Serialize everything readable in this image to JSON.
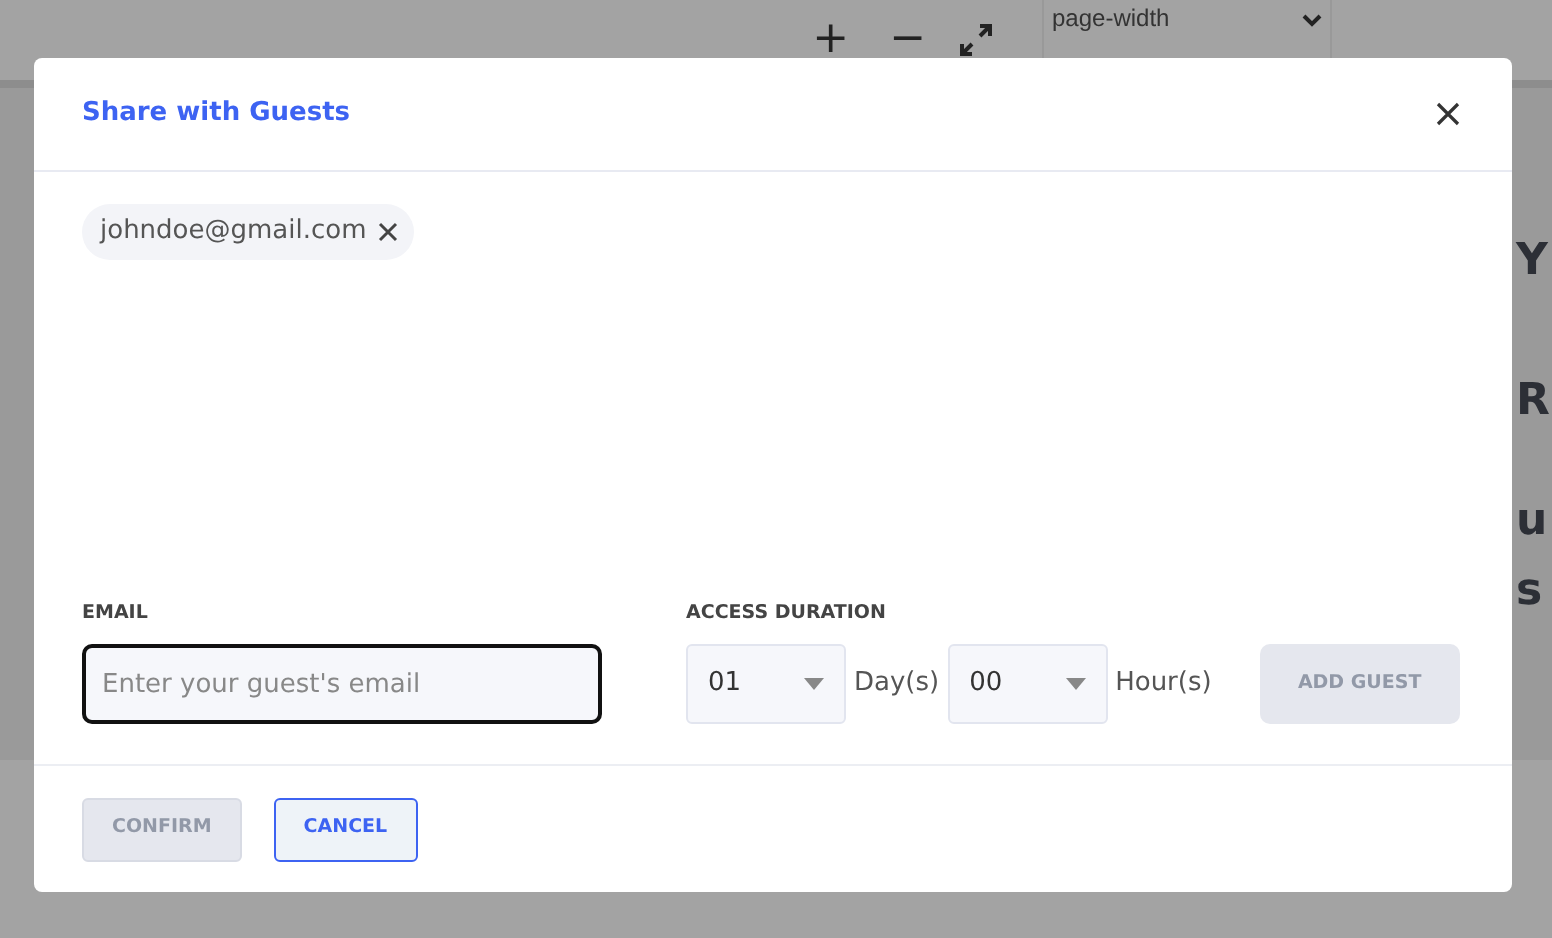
{
  "toolbar": {
    "zoom_in": "+",
    "zoom_out": "−",
    "zoom_select": "page-width"
  },
  "background_text": [
    "Y",
    "R",
    "u",
    "s"
  ],
  "dialog": {
    "title": "Share with Guests",
    "guests": [
      {
        "email": "johndoe@gmail.com"
      }
    ],
    "email": {
      "label": "EMAIL",
      "placeholder": "Enter your guest's email",
      "focused": true
    },
    "access_duration": {
      "label": "ACCESS DURATION",
      "days": "01",
      "days_unit": "Day(s)",
      "hours": "00",
      "hours_unit": "Hour(s)"
    },
    "add_guest": {
      "label": "ADD GUEST",
      "disabled": true
    },
    "buttons": [
      {
        "label": "CONFIRM",
        "kind": "primary",
        "disabled": true
      },
      {
        "label": "CANCEL",
        "kind": "secondary",
        "disabled": false
      }
    ]
  }
}
